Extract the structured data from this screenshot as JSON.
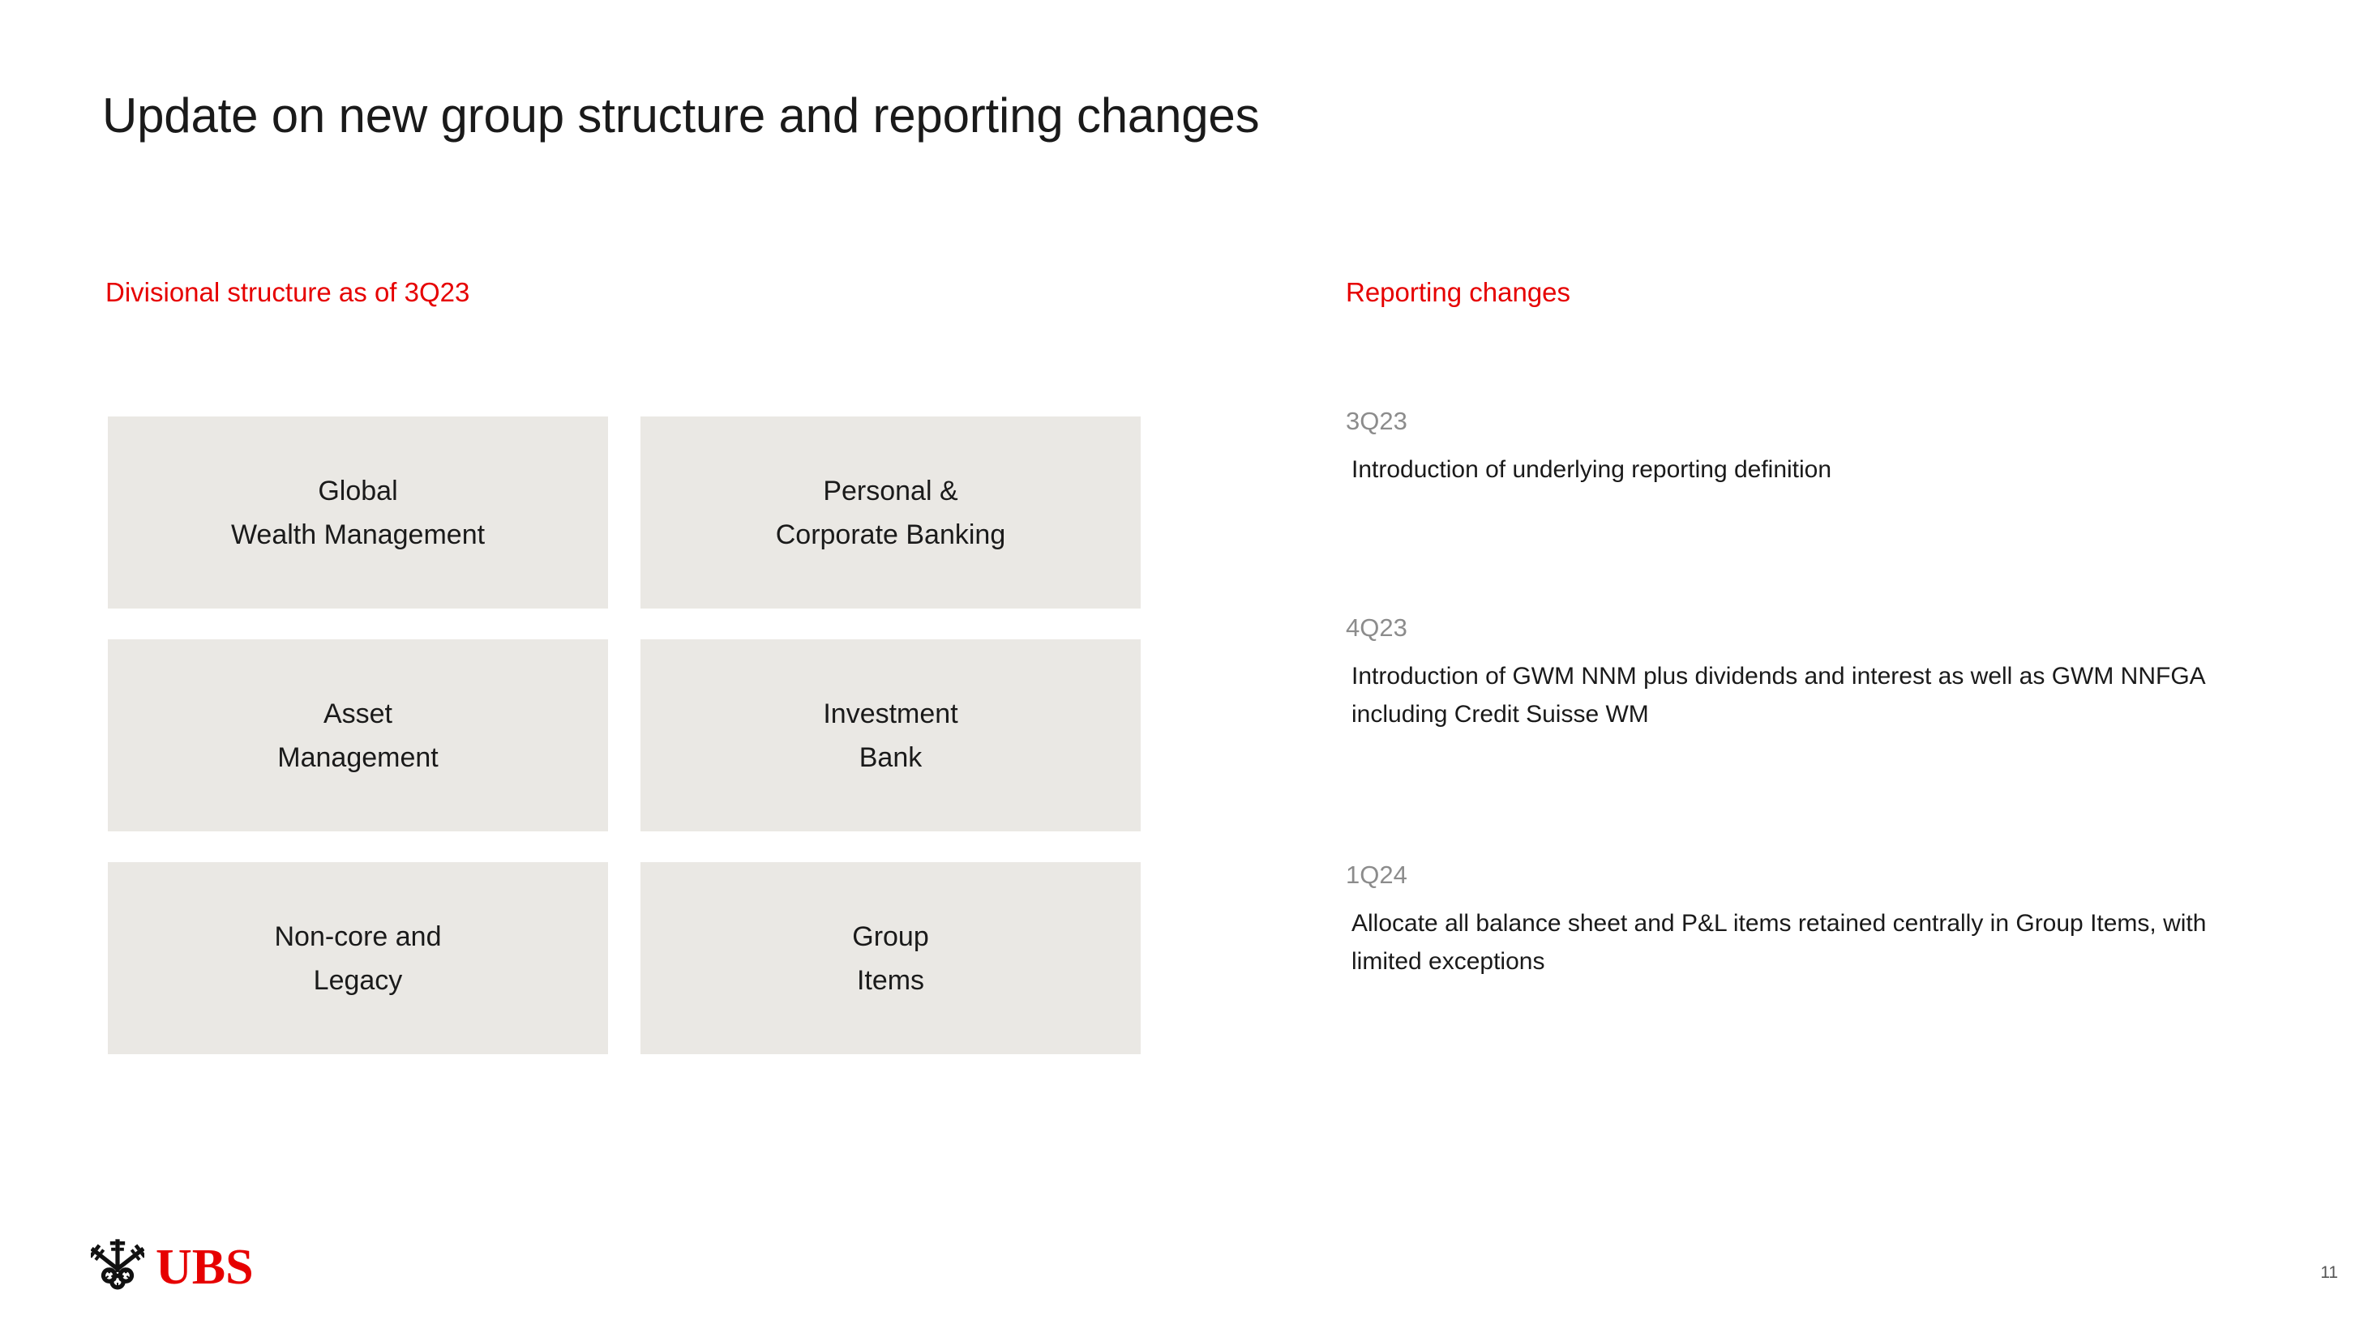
{
  "slide": {
    "title": "Update on new group structure and reporting changes",
    "page_number": "11",
    "accent_red": "#e60000",
    "box_fill": "#eae8e4",
    "label_gray": "#8c8c8c"
  },
  "divisional": {
    "header": "Divisional structure as of 3Q23",
    "boxes": [
      {
        "line1": "Global",
        "line2": "Wealth Management"
      },
      {
        "line1": "Personal &",
        "line2": "Corporate Banking"
      },
      {
        "line1": "Asset",
        "line2": "Management"
      },
      {
        "line1": "Investment",
        "line2": "Bank"
      },
      {
        "line1": "Non-core and",
        "line2": "Legacy"
      },
      {
        "line1": "Group",
        "line2": "Items"
      }
    ]
  },
  "reporting": {
    "header": "Reporting changes",
    "entries": [
      {
        "period": "3Q23",
        "text": "Introduction of underlying reporting definition"
      },
      {
        "period": "4Q23",
        "text": "Introduction of GWM NNM plus dividends and interest as well as GWM NNFGA including Credit Suisse WM"
      },
      {
        "period": "1Q24",
        "text": "Allocate all balance sheet and P&L items retained centrally in Group Items, with limited exceptions"
      }
    ]
  },
  "footer": {
    "logo_word": "UBS",
    "logo_icon": "ubs-three-keys-icon"
  }
}
